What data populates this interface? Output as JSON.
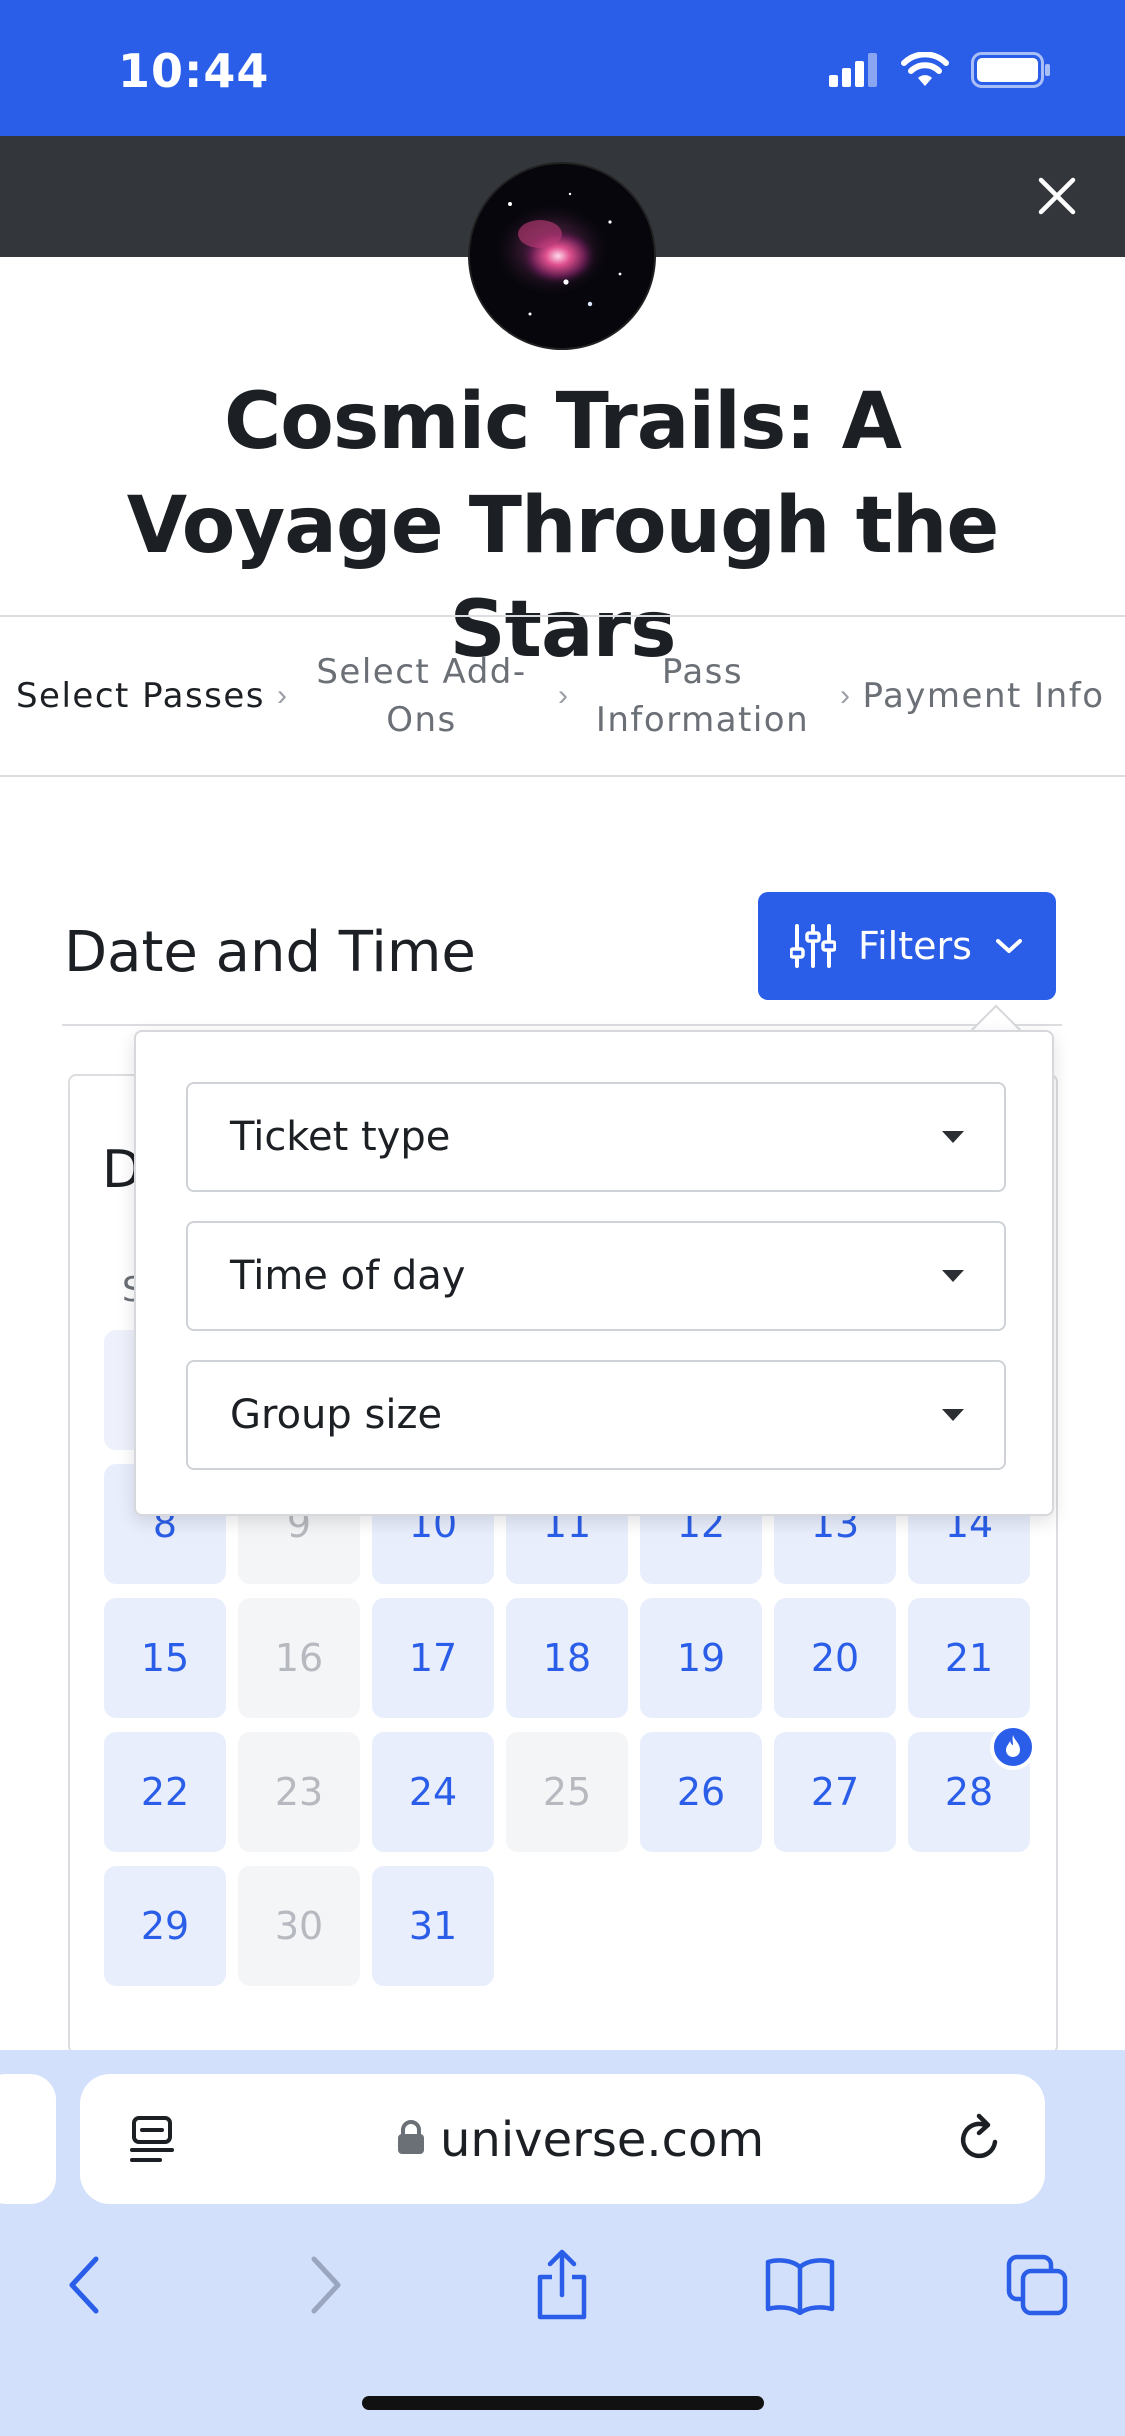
{
  "status_bar": {
    "time": "10:44"
  },
  "event": {
    "title": "Cosmic Trails: A Voyage Through the Stars"
  },
  "stepper": {
    "steps": [
      {
        "label": "Select Passes",
        "active": true
      },
      {
        "label": "Select Add-Ons",
        "active": false
      },
      {
        "label": "Pass Information",
        "active": false
      },
      {
        "label": "Payment Info",
        "active": false
      }
    ]
  },
  "date_time": {
    "title": "Date and Time",
    "filters_label": "Filters",
    "calendar_partial_heading": "D",
    "calendar_partial_weekday": "S"
  },
  "filters_menu": {
    "ticket_type": "Ticket type",
    "time_of_day": "Time of day",
    "group_size": "Group size"
  },
  "calendar": {
    "days": [
      {
        "label": "8",
        "available": true
      },
      {
        "label": "9",
        "available": false
      },
      {
        "label": "10",
        "available": true
      },
      {
        "label": "11",
        "available": true
      },
      {
        "label": "12",
        "available": true
      },
      {
        "label": "13",
        "available": true
      },
      {
        "label": "14",
        "available": true
      },
      {
        "label": "15",
        "available": true
      },
      {
        "label": "16",
        "available": false
      },
      {
        "label": "17",
        "available": true
      },
      {
        "label": "18",
        "available": true
      },
      {
        "label": "19",
        "available": true
      },
      {
        "label": "20",
        "available": true
      },
      {
        "label": "21",
        "available": true
      },
      {
        "label": "22",
        "available": true
      },
      {
        "label": "23",
        "available": false
      },
      {
        "label": "24",
        "available": true
      },
      {
        "label": "25",
        "available": false
      },
      {
        "label": "26",
        "available": true
      },
      {
        "label": "27",
        "available": true
      },
      {
        "label": "28",
        "available": true,
        "badge": "flame-icon"
      },
      {
        "label": "29",
        "available": true
      },
      {
        "label": "30",
        "available": false
      },
      {
        "label": "31",
        "available": true
      }
    ]
  },
  "browser": {
    "url": "universe.com"
  },
  "colors": {
    "accent": "#2a5ee8",
    "header_dark": "#33363b",
    "browser_bar": "#d3e0fb"
  }
}
